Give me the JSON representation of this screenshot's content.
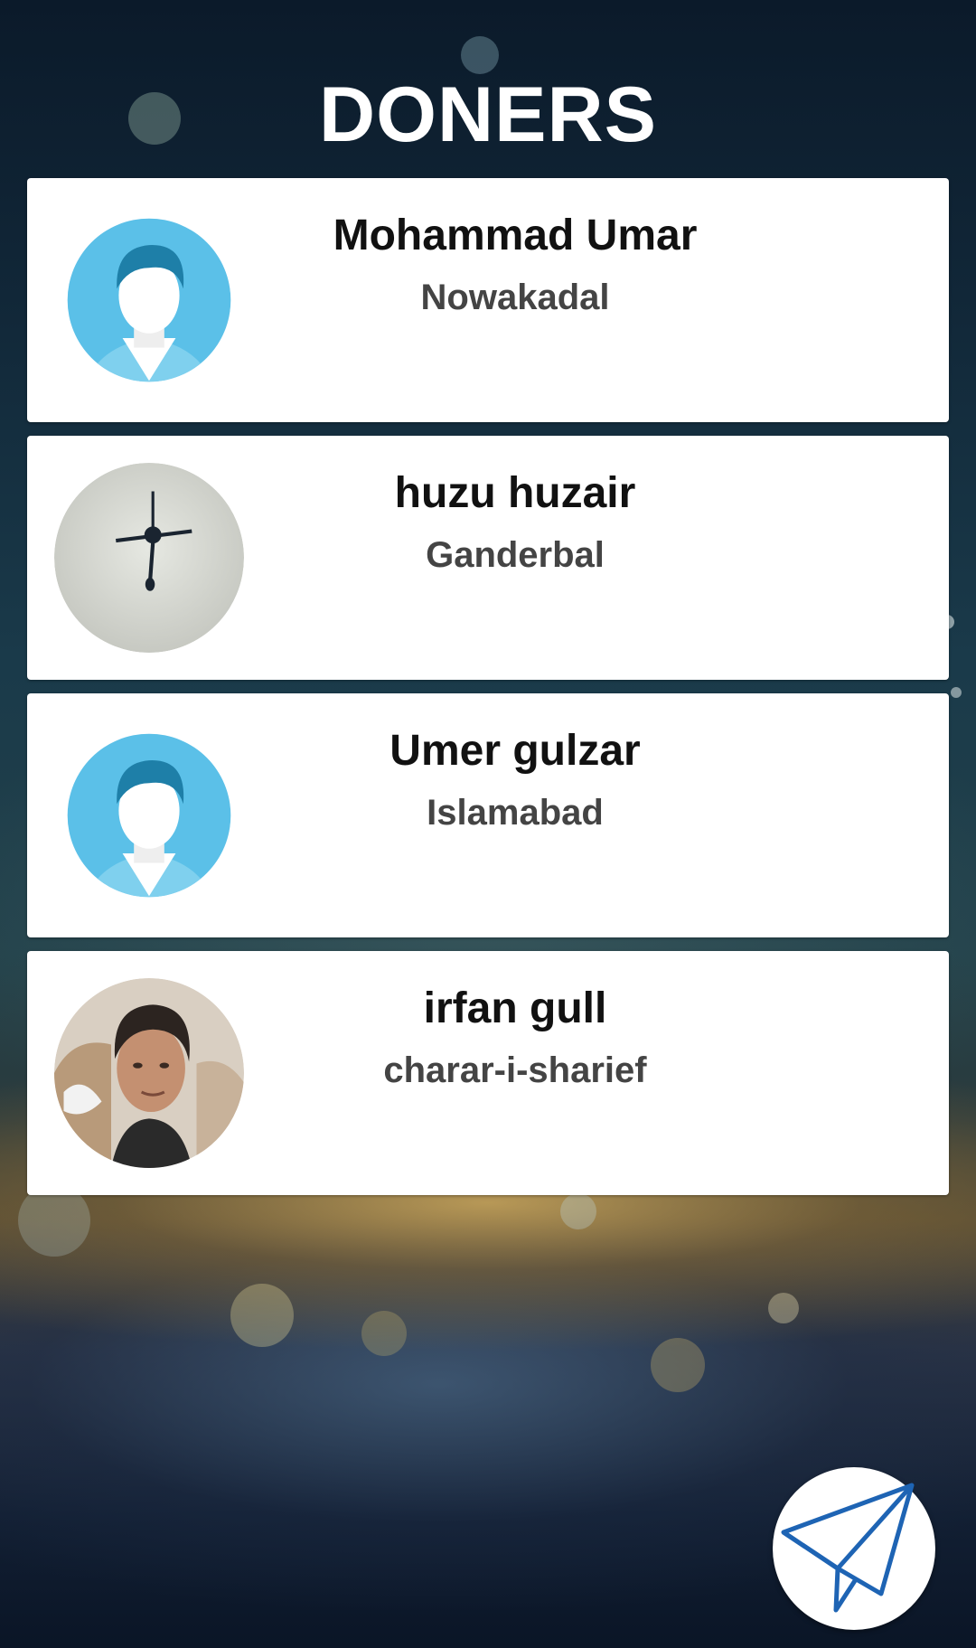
{
  "page": {
    "title": "DONERS"
  },
  "donors": [
    {
      "name": "Mohammad Umar",
      "place": "Nowakadal",
      "avatar": "default-male-avatar"
    },
    {
      "name": "huzu huzair",
      "place": "Ganderbal",
      "avatar": "photo-ceiling-fan"
    },
    {
      "name": "Umer gulzar",
      "place": "Islamabad",
      "avatar": "default-male-avatar"
    },
    {
      "name": "irfan gull",
      "place": "charar-i-sharief",
      "avatar": "photo-young-man"
    }
  ],
  "fab": {
    "icon": "paper-plane-icon"
  },
  "colors": {
    "title_text": "#ffffff",
    "card_background": "#ffffff",
    "avatar_blue": "#5bc0e8",
    "icon_blue": "#1e64b4"
  }
}
